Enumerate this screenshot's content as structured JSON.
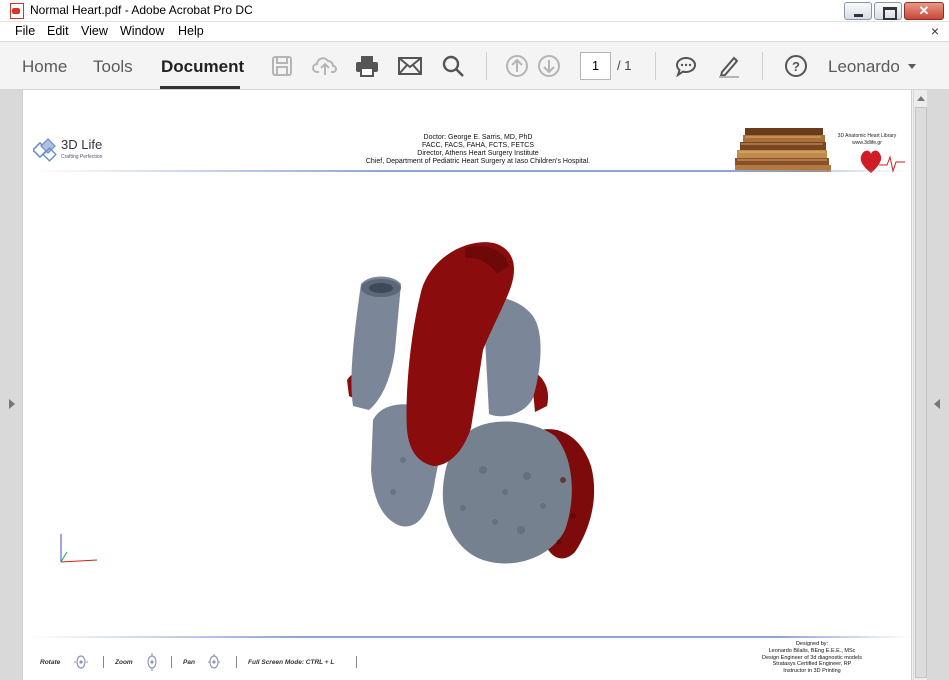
{
  "window": {
    "title": "Normal Heart.pdf - Adobe Acrobat Pro DC"
  },
  "menu": {
    "items": [
      "File",
      "Edit",
      "View",
      "Window",
      "Help"
    ],
    "close_symbol": "×"
  },
  "toolbar": {
    "tabs": [
      "Home",
      "Tools",
      "Document"
    ],
    "active_tab": "Document",
    "icons": [
      "save-icon",
      "cloud-upload-icon",
      "print-icon",
      "email-icon",
      "search-icon",
      "page-up-icon",
      "page-down-icon",
      "comment-icon",
      "fill-sign-icon",
      "help-icon"
    ],
    "page_current": "1",
    "page_total": "/ 1",
    "user": "Leonardo"
  },
  "document": {
    "logo_text": "3D Life",
    "logo_tagline": "Crafting Perfection",
    "header_lines": [
      "Doctor: George E. Sarris, MD, PhD",
      "FACC, FACS, FAHA, FCTS, FETCS",
      "Director, Athens Heart Surgery Institute",
      "Chief, Department of Pediatric Heart Surgery at Iaso Children's Hospital."
    ],
    "library_lines": [
      "3D Anatomic Heart Library",
      "www.3dlife.gr"
    ],
    "controls": {
      "rotate": "Rotate",
      "zoom": "Zoom",
      "pan": "Pan",
      "fullscreen": "Full Screen Mode:  CTRL + L"
    },
    "credits": [
      "Designed by:",
      "Leonardo Bilalis, BEng E.E.E., MSc",
      "Design Engineer of 3d diagnostic models",
      "Stratasys Certified Engineer, RP",
      "Instructor in 3D Printing"
    ]
  },
  "colors": {
    "heart_red": "#8b0c0c",
    "heart_grey": "#7b8799",
    "accent_rule": "#8fa6d4"
  }
}
